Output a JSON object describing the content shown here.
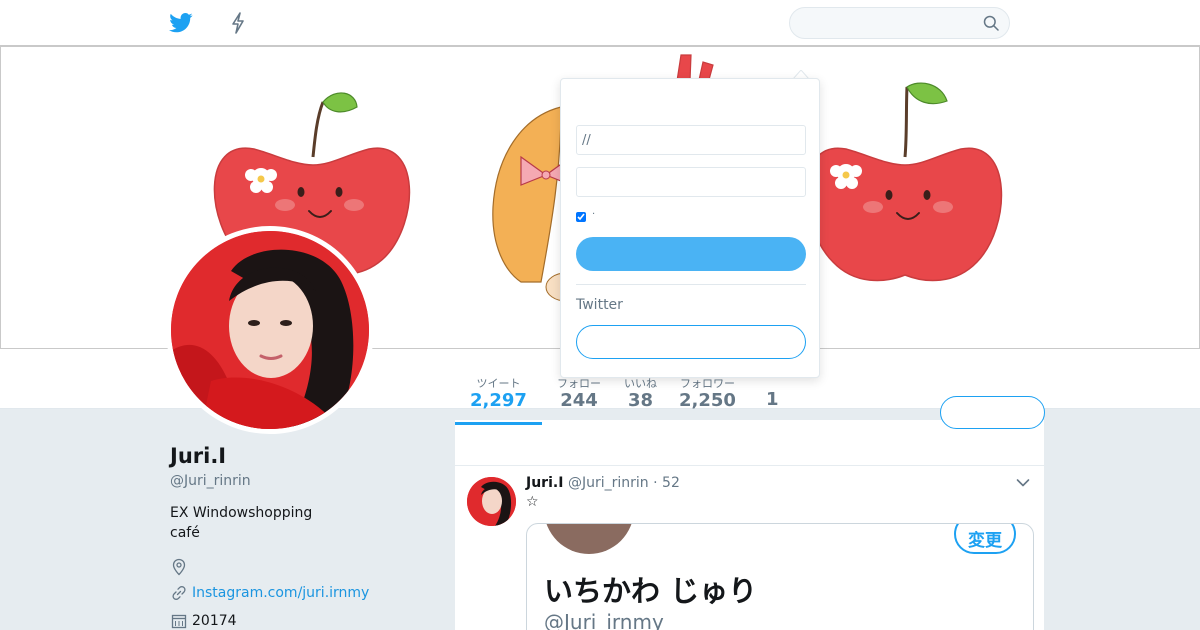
{
  "nav": {
    "search_placeholder": "",
    "bird_icon": "twitter-bird-icon",
    "moments_icon": "lightning-bolt-icon"
  },
  "colors": {
    "accent": "#1da1f2",
    "background": "#e6ecf0",
    "apple_red": "#e8474a"
  },
  "profile": {
    "name": "Juri.I",
    "handle": "@Juri_rinrin",
    "bio": " EX Windowshopping\ncafé",
    "location": "",
    "url": "Instagram.com/juri.irnmy",
    "joined": "20174"
  },
  "stats": [
    {
      "label": "ツイート",
      "value": "2,297"
    },
    {
      "label": "フォロー",
      "value": "244"
    },
    {
      "label": "いいね",
      "value": "38"
    },
    {
      "label": "フォロワー",
      "value": "2,250"
    },
    {
      "label": "",
      "value": "1"
    }
  ],
  "follow_label": "",
  "tweet": {
    "name": "Juri.I",
    "handle": "@Juri_rinrin · 52",
    "text": "☆",
    "media": {
      "name": "いちかわ じゅり",
      "handle": "@Juri_irnmy",
      "button": "変更"
    }
  },
  "login": {
    "username_value": "//",
    "password_value": "",
    "remember_label": "·",
    "login_label": "",
    "signup_text": "Twitter",
    "signup_label": ""
  }
}
